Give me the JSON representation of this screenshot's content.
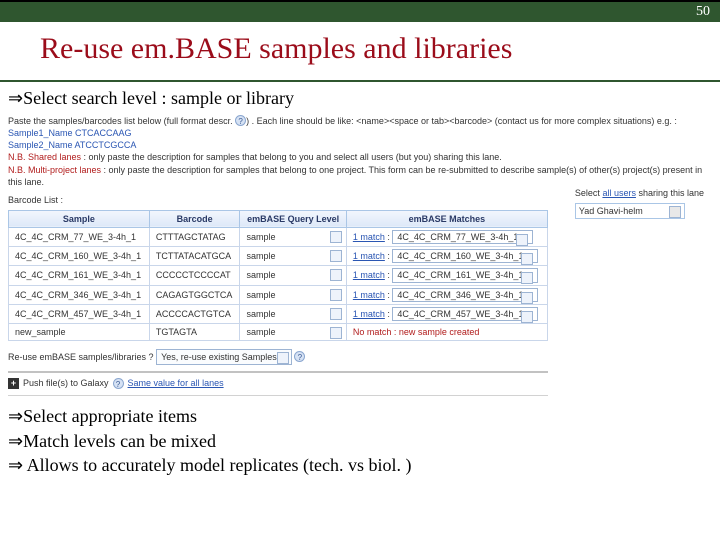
{
  "page_number": "50",
  "title": "Re-use em.BASE samples and libraries",
  "bullet1_prefix": "Select search level : ",
  "bullet1_em": "sample or library",
  "shot": {
    "intro_line": "Paste the samples/barcodes list below (full format descr.  ",
    "intro_line_suffix": ") . Each line should be like: <name><space or tab><barcode> (contact us for more complex situations) e.g. :",
    "ex1": "Sample1_Name CTCACCAAG",
    "ex2": "Sample2_Name ATCCTCGCCA",
    "nb1_label": "N.B. Shared lanes",
    "nb1_text": " : only paste the description for samples that belong to you and select all users (but you) sharing this lane.",
    "nb2_label": "N.B. Multi-project lanes",
    "nb2_text": " : only paste the description for samples that belong to one project. This form can be re-submitted to describe sample(s) of other(s) project(s) present in this lane.",
    "barcode_label": "Barcode List :",
    "side_sel_text": "Select ",
    "side_sel_link": "all users",
    "side_sel_tail": " sharing this lane",
    "side_value": "Yad Ghavi-helm",
    "headers": {
      "sample": "Sample",
      "barcode": "Barcode",
      "level": "emBASE Query Level",
      "matches": "emBASE Matches"
    },
    "rows": [
      {
        "s": "4C_4C_CRM_77_WE_3-4h_1",
        "b": "CTTTAGCTATAG",
        "l": "sample",
        "m": "1 match",
        "r": "4C_4C_CRM_77_WE_3-4h_1"
      },
      {
        "s": "4C_4C_CRM_160_WE_3-4h_1",
        "b": "TCTTATACATGCA",
        "l": "sample",
        "m": "1 match",
        "r": "4C_4C_CRM_160_WE_3-4h_1"
      },
      {
        "s": "4C_4C_CRM_161_WE_3-4h_1",
        "b": "CCCCCTCCCCAT",
        "l": "sample",
        "m": "1 match",
        "r": "4C_4C_CRM_161_WE_3-4h_1"
      },
      {
        "s": "4C_4C_CRM_346_WE_3-4h_1",
        "b": "CAGAGTGGCTCA",
        "l": "sample",
        "m": "1 match",
        "r": "4C_4C_CRM_346_WE_3-4h_1"
      },
      {
        "s": "4C_4C_CRM_457_WE_3-4h_1",
        "b": "ACCCCACTGTCA",
        "l": "sample",
        "m": "1 match",
        "r": "4C_4C_CRM_457_WE_3-4h_1"
      },
      {
        "s": "new_sample",
        "b": "TGTAGTA",
        "l": "sample",
        "m": "No match : new sample created",
        "r": ""
      }
    ],
    "reuse_label": "Re-use emBASE samples/libraries ?",
    "reuse_value": "Yes, re-use existing Samples",
    "galaxy_label": "Push file(s) to Galaxy",
    "galaxy_link": "Same value for all lanes"
  },
  "bottom": {
    "b1": "Select appropriate items",
    "b2": "Match levels can be mixed",
    "b3": " Allows to accurately model replicates (tech. vs biol. )"
  }
}
